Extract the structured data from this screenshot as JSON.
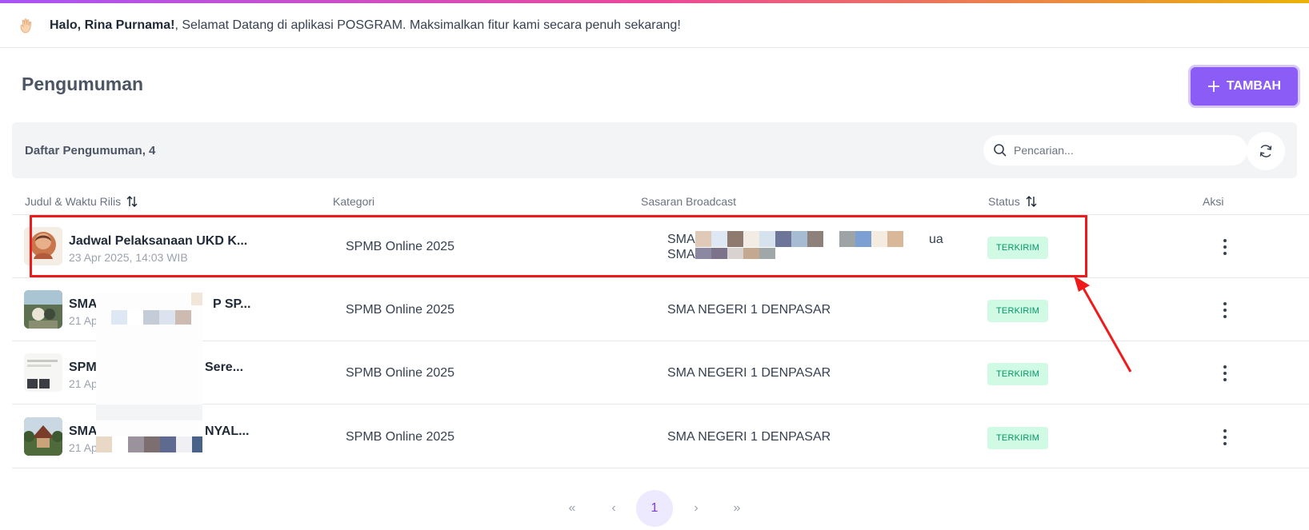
{
  "welcome": {
    "greeting": "Halo, Rina Purnama!",
    "message": ", Selamat Datang di aplikasi POSGRAM. Maksimalkan fitur kami secara penuh sekarang!",
    "icon": "wave-hand-icon"
  },
  "page": {
    "title": "Pengumuman",
    "add_button": "TAMBAH"
  },
  "list": {
    "label": "Daftar Pengumuman, 4",
    "search_placeholder": "Pencarian..."
  },
  "table": {
    "headers": {
      "title_time": "Judul & Waktu Rilis",
      "category": "Kategori",
      "target": "Sasaran Broadcast",
      "status": "Status",
      "action": "Aksi"
    },
    "rows": [
      {
        "title": "Jadwal Pelaksanaan UKD K...",
        "time": "23 Apr 2025, 14:03 WIB",
        "category": "SPMB Online 2025",
        "target_line1": "SMA",
        "target_line1_end": "ua",
        "target_line2": "SMA",
        "status": "TERKIRIM"
      },
      {
        "title_start": "SMA",
        "title_end": "P SP...",
        "time_start": "21 Apr",
        "category": "SPMB Online 2025",
        "target": "SMA NEGERI 1 DENPASAR",
        "status": "TERKIRIM"
      },
      {
        "title_start": "SPM",
        "title_end": "Sere...",
        "time_start": "21 Apr",
        "category": "SPMB Online 2025",
        "target": "SMA NEGERI 1 DENPASAR",
        "status": "TERKIRIM"
      },
      {
        "title_start": "SMA",
        "title_end": "NYAL...",
        "time_start": "21 Ap",
        "category": "SPMB Online 2025",
        "target": "SMA NEGERI 1 DENPASAR",
        "status": "TERKIRIM"
      }
    ]
  },
  "pagination": {
    "first": "«",
    "prev": "‹",
    "current": "1",
    "next": "›",
    "last": "»"
  },
  "colors": {
    "accent": "#8b5cf6",
    "status_bg": "#d1fae5",
    "status_text": "#059669",
    "highlight": "#ef1b1b"
  }
}
